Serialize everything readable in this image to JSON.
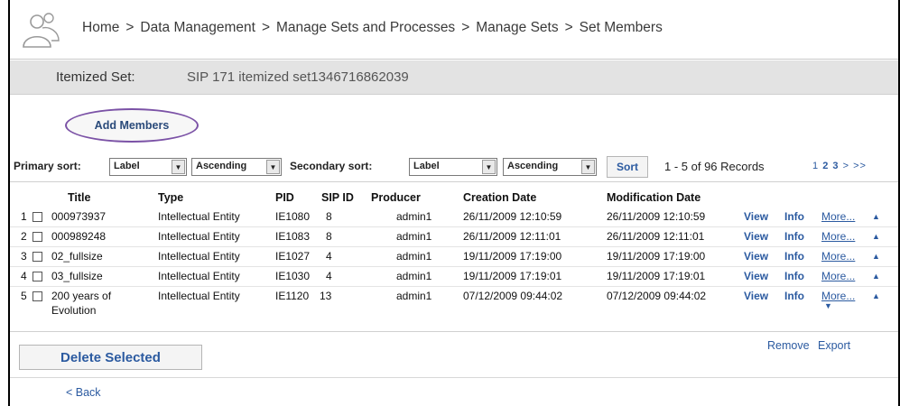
{
  "breadcrumb": [
    "Home",
    "Data Management",
    "Manage Sets and Processes",
    "Manage Sets",
    "Set Members"
  ],
  "breadcrumb_separator": ">",
  "set": {
    "label": "Itemized Set:",
    "name": "SIP 171 itemized set1346716862039"
  },
  "add_members_label": "Add Members",
  "sort": {
    "primary_label": "Primary sort:",
    "primary_field": "Label",
    "primary_order": "Ascending",
    "secondary_label": "Secondary sort:",
    "secondary_field": "Label",
    "secondary_order": "Ascending",
    "sort_button": "Sort",
    "records_text": "1 - 5  of 96 Records",
    "pages": [
      "1",
      "2",
      "3",
      ">",
      ">>"
    ]
  },
  "table": {
    "headers": [
      "Title",
      "Type",
      "PID",
      "SIP ID",
      "Producer",
      "Creation Date",
      "Modification Date"
    ],
    "rows": [
      {
        "num": "1",
        "title": "000973937",
        "title2": "",
        "type": "Intellectual Entity",
        "pid": "IE1080",
        "sip": "8",
        "producer": "admin1",
        "created": "26/11/2009 12:10:59",
        "modified": "26/11/2009 12:10:59",
        "view": "View",
        "info": "Info",
        "more": "More..."
      },
      {
        "num": "2",
        "title": "000989248",
        "title2": "",
        "type": "Intellectual Entity",
        "pid": "IE1083",
        "sip": "8",
        "producer": "admin1",
        "created": "26/11/2009 12:11:01",
        "modified": "26/11/2009 12:11:01",
        "view": "View",
        "info": "Info",
        "more": "More..."
      },
      {
        "num": "3",
        "title": "02_fullsize",
        "title2": "",
        "type": "Intellectual Entity",
        "pid": "IE1027",
        "sip": "4",
        "producer": "admin1",
        "created": "19/11/2009 17:19:00",
        "modified": "19/11/2009 17:19:00",
        "view": "View",
        "info": "Info",
        "more": "More..."
      },
      {
        "num": "4",
        "title": "03_fullsize",
        "title2": "",
        "type": "Intellectual Entity",
        "pid": "IE1030",
        "sip": "4",
        "producer": "admin1",
        "created": "19/11/2009 17:19:01",
        "modified": "19/11/2009 17:19:01",
        "view": "View",
        "info": "Info",
        "more": "More..."
      },
      {
        "num": "5",
        "title": "200 years of",
        "title2": "Evolution",
        "type": "Intellectual Entity",
        "pid": "IE1120",
        "sip": "13",
        "producer": "admin1",
        "created": "07/12/2009 09:44:02",
        "modified": "07/12/2009 09:44:02",
        "view": "View",
        "info": "Info",
        "more": "More..."
      }
    ]
  },
  "delete_label": "Delete Selected",
  "remove_label": "Remove",
  "export_label": "Export",
  "back_label": "< Back",
  "colors": {
    "link": "#2b5aa0",
    "setbar_bg": "#e3e3e3",
    "accent_circle": "#7b52a6"
  }
}
